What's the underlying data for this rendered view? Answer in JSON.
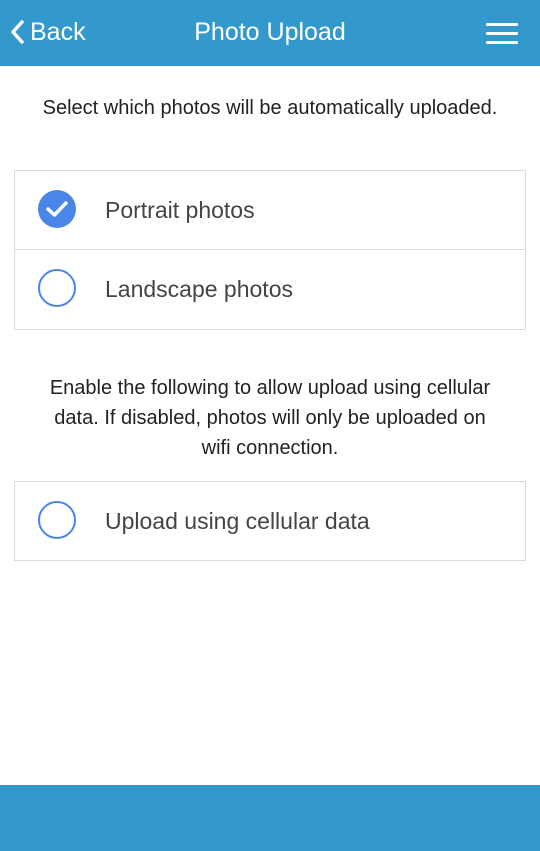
{
  "header": {
    "back_label": "Back",
    "title": "Photo Upload",
    "back_icon": "chevron-left-icon",
    "menu_icon": "hamburger-menu-icon",
    "color": "#3399cc"
  },
  "orientation_section": {
    "description": "Select which photos will be automatically uploaded.",
    "options": [
      {
        "label": "Portrait photos",
        "checked": true
      },
      {
        "label": "Landscape photos",
        "checked": false
      }
    ]
  },
  "cellular_section": {
    "description": "Enable the following to allow upload using cellular data. If disabled, photos will only be uploaded on wifi connection.",
    "options": [
      {
        "label": "Upload using cellular data",
        "checked": false
      }
    ]
  },
  "colors": {
    "accent": "#4a86e8",
    "header_bg": "#3399cc",
    "footer_bg": "#3399cc"
  }
}
